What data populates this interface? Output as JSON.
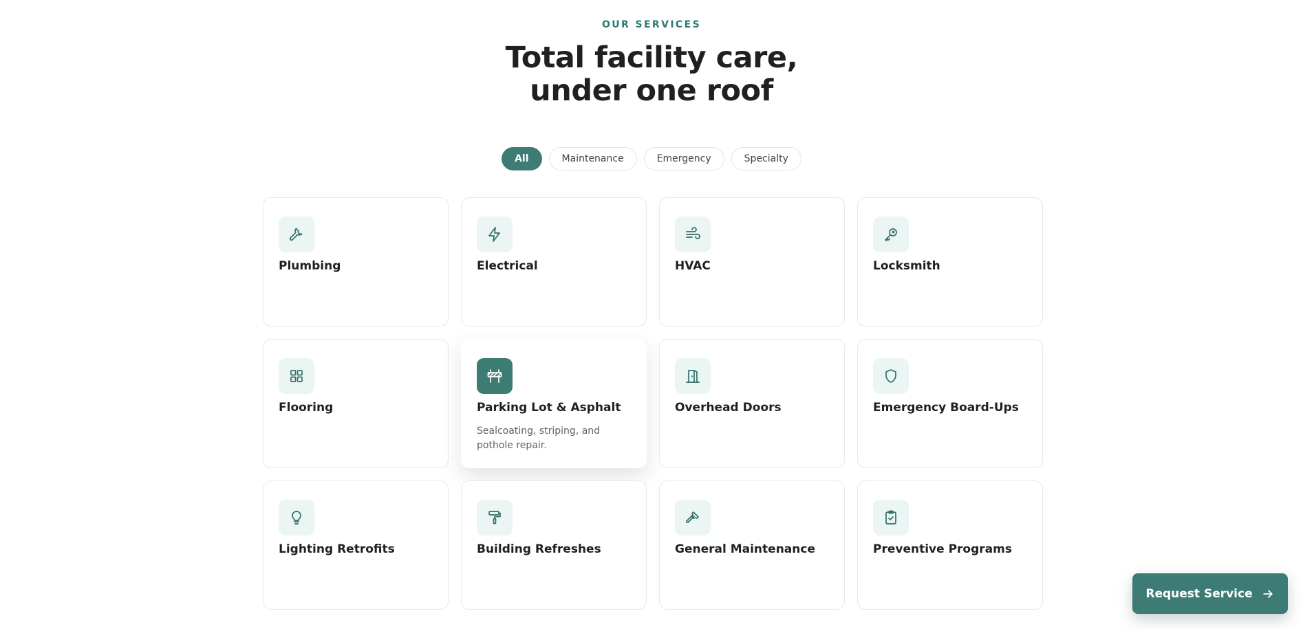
{
  "section": {
    "eyebrow": "OUR SERVICES",
    "headline_line1": "Total facility care,",
    "headline_line2": "under one roof"
  },
  "filters": {
    "all": "All",
    "maintenance": "Maintenance",
    "emergency": "Emergency",
    "specialty": "Specialty",
    "active": "All"
  },
  "services": [
    {
      "title": "Plumbing",
      "icon": "wrench-icon"
    },
    {
      "title": "Electrical",
      "icon": "lightning-icon"
    },
    {
      "title": "HVAC",
      "icon": "wind-icon"
    },
    {
      "title": "Locksmith",
      "icon": "key-icon"
    },
    {
      "title": "Flooring",
      "icon": "grid-icon"
    },
    {
      "title": "Parking Lot & Asphalt",
      "icon": "road-barrier-icon",
      "description": "Sealcoating, striping, and pothole repair.",
      "highlighted": true
    },
    {
      "title": "Overhead Doors",
      "icon": "door-icon"
    },
    {
      "title": "Emergency Board-Ups",
      "icon": "shield-icon"
    },
    {
      "title": "Lighting Retrofits",
      "icon": "lightbulb-icon"
    },
    {
      "title": "Building Refreshes",
      "icon": "paint-roller-icon"
    },
    {
      "title": "General Maintenance",
      "icon": "hammer-icon"
    },
    {
      "title": "Preventive Programs",
      "icon": "clipboard-check-icon"
    }
  ],
  "cta": {
    "label": "Request Service",
    "icon": "arrow-right-icon"
  },
  "colors": {
    "accent": "#3d7c74",
    "icon_tile_bg": "#ebf5f3"
  }
}
